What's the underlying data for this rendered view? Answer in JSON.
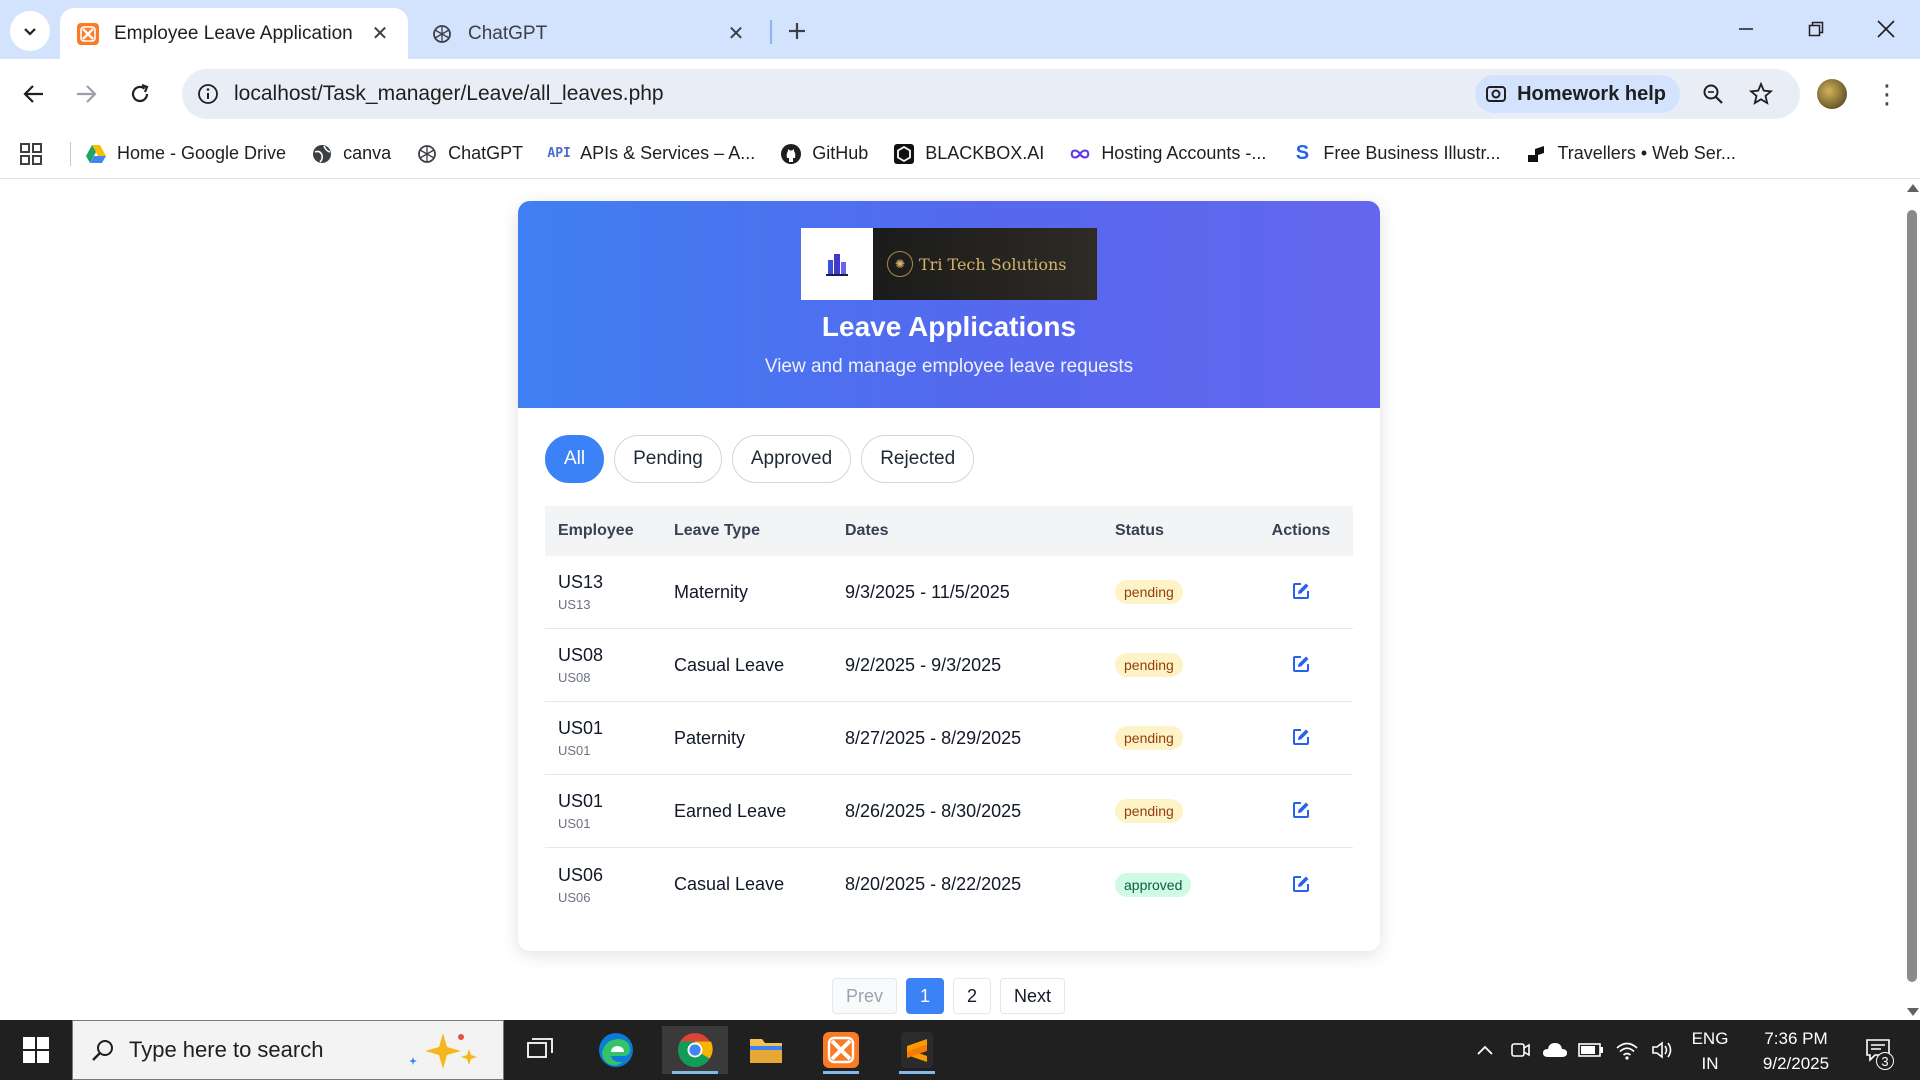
{
  "browser": {
    "tabs": [
      {
        "title": "Employee Leave Application",
        "icon": "xampp-icon",
        "active": true
      },
      {
        "title": "ChatGPT",
        "icon": "chatgpt-icon",
        "active": false
      }
    ],
    "url": "localhost/Task_manager/Leave/all_leaves.php",
    "homework_chip": "Homework help",
    "bookmarks": [
      {
        "label": "Home - Google Drive",
        "icon": "google-drive-icon"
      },
      {
        "label": "canva",
        "icon": "globe-icon"
      },
      {
        "label": "ChatGPT",
        "icon": "chatgpt-icon"
      },
      {
        "label": "APIs & Services – A...",
        "icon": "api-icon"
      },
      {
        "label": "GitHub",
        "icon": "github-icon"
      },
      {
        "label": "BLACKBOX.AI",
        "icon": "blackbox-icon"
      },
      {
        "label": "Hosting Accounts -...",
        "icon": "infinity-icon"
      },
      {
        "label": "Free Business Illustr...",
        "icon": "storyset-icon"
      },
      {
        "label": "Travellers • Web Ser...",
        "icon": "travellers-icon"
      }
    ]
  },
  "page": {
    "logo_text": "Tri Tech Solutions",
    "title": "Leave Applications",
    "subtitle": "View and manage employee leave requests",
    "filters": [
      {
        "label": "All",
        "active": true
      },
      {
        "label": "Pending",
        "active": false
      },
      {
        "label": "Approved",
        "active": false
      },
      {
        "label": "Rejected",
        "active": false
      }
    ],
    "columns": {
      "employee": "Employee",
      "leave_type": "Leave Type",
      "dates": "Dates",
      "status": "Status",
      "actions": "Actions"
    },
    "rows": [
      {
        "employee": "US13",
        "employee_sub": "US13",
        "leave_type": "Maternity",
        "dates": "9/3/2025 - 11/5/2025",
        "status": "pending"
      },
      {
        "employee": "US08",
        "employee_sub": "US08",
        "leave_type": "Casual Leave",
        "dates": "9/2/2025 - 9/3/2025",
        "status": "pending"
      },
      {
        "employee": "US01",
        "employee_sub": "US01",
        "leave_type": "Paternity",
        "dates": "8/27/2025 - 8/29/2025",
        "status": "pending"
      },
      {
        "employee": "US01",
        "employee_sub": "US01",
        "leave_type": "Earned Leave",
        "dates": "8/26/2025 - 8/30/2025",
        "status": "pending"
      },
      {
        "employee": "US06",
        "employee_sub": "US06",
        "leave_type": "Casual Leave",
        "dates": "8/20/2025 - 8/22/2025",
        "status": "approved"
      }
    ],
    "pagination": {
      "prev": "Prev",
      "pages": [
        "1",
        "2"
      ],
      "current": "1",
      "next": "Next"
    }
  },
  "taskbar": {
    "search_placeholder": "Type here to search",
    "language": "ENG",
    "region": "IN",
    "time": "7:36 PM",
    "date": "9/2/2025",
    "notification_count": "3"
  },
  "colors": {
    "accent": "#3b82f6",
    "header_gradient_start": "#3f7ff3",
    "header_gradient_end": "#6466ef",
    "pending_bg": "#fef3c7",
    "approved_bg": "#d1fae5"
  }
}
